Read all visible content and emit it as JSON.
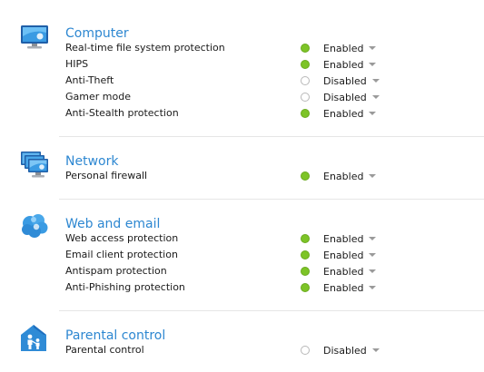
{
  "colors": {
    "title": "#2d87d1",
    "enabled_dot": "#7dc427",
    "divider": "#e6e6e6"
  },
  "sections": [
    {
      "title": "Computer",
      "icon": "monitor-icon",
      "rows": [
        {
          "label": "Real-time file system protection",
          "status": "Enabled",
          "on": true
        },
        {
          "label": "HIPS",
          "status": "Enabled",
          "on": true
        },
        {
          "label": "Anti-Theft",
          "status": "Disabled",
          "on": false
        },
        {
          "label": "Gamer mode",
          "status": "Disabled",
          "on": false
        },
        {
          "label": "Anti-Stealth protection",
          "status": "Enabled",
          "on": true
        }
      ]
    },
    {
      "title": "Network",
      "icon": "network-icon",
      "rows": [
        {
          "label": "Personal firewall",
          "status": "Enabled",
          "on": true
        }
      ]
    },
    {
      "title": "Web and email",
      "icon": "cloud-icon",
      "rows": [
        {
          "label": "Web access protection",
          "status": "Enabled",
          "on": true
        },
        {
          "label": "Email client protection",
          "status": "Enabled",
          "on": true
        },
        {
          "label": "Antispam protection",
          "status": "Enabled",
          "on": true
        },
        {
          "label": "Anti-Phishing protection",
          "status": "Enabled",
          "on": true
        }
      ]
    },
    {
      "title": "Parental control",
      "icon": "parental-control-icon",
      "rows": [
        {
          "label": "Parental control",
          "status": "Disabled",
          "on": false
        }
      ]
    }
  ]
}
